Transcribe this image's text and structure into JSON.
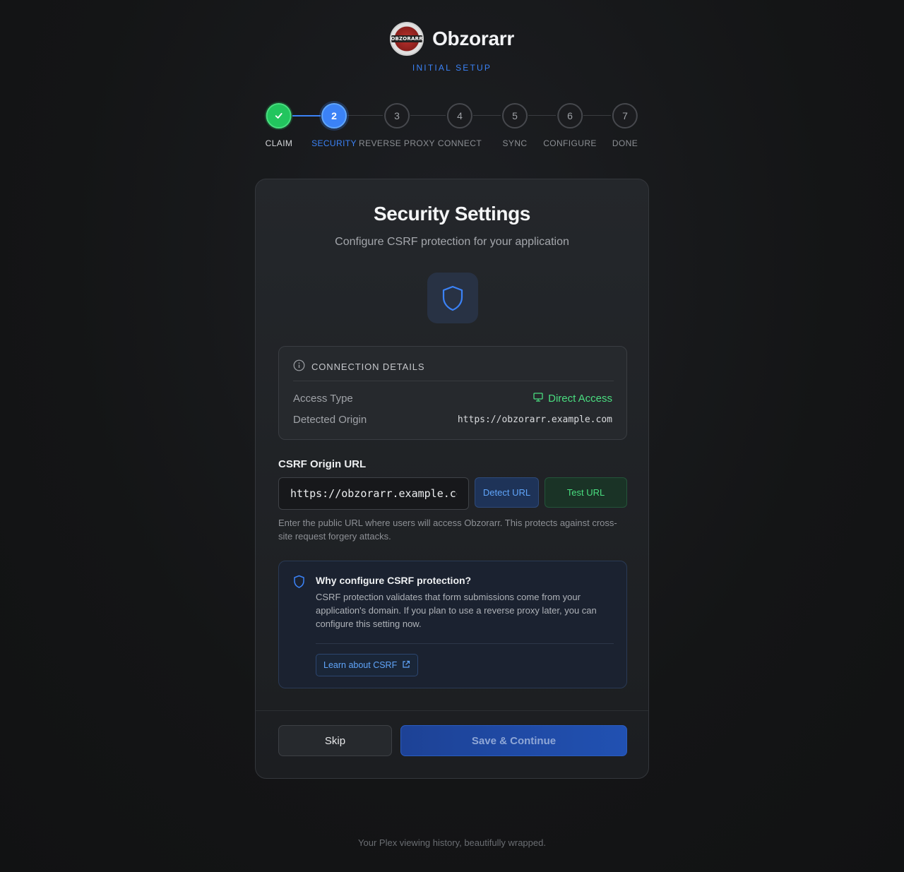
{
  "brand": {
    "name": "Obzorarr",
    "logo_text": "OBZORARR",
    "subtitle": "INITIAL SETUP"
  },
  "steps": [
    {
      "number": "✓",
      "label": "CLAIM",
      "state": "complete"
    },
    {
      "number": "2",
      "label": "SECURITY",
      "state": "active"
    },
    {
      "number": "3",
      "label": "REVERSE PROXY",
      "state": "pending"
    },
    {
      "number": "4",
      "label": "CONNECT",
      "state": "pending"
    },
    {
      "number": "5",
      "label": "SYNC",
      "state": "pending"
    },
    {
      "number": "6",
      "label": "CONFIGURE",
      "state": "pending"
    },
    {
      "number": "7",
      "label": "DONE",
      "state": "pending"
    }
  ],
  "card": {
    "title": "Security Settings",
    "subtitle": "Configure CSRF protection for your application",
    "details": {
      "heading": "CONNECTION DETAILS",
      "access_type_label": "Access Type",
      "access_type_value": "Direct Access",
      "origin_label": "Detected Origin",
      "origin_value": "https://obzorarr.example.com"
    },
    "csrf": {
      "label": "CSRF Origin URL",
      "value": "https://obzorarr.example.com",
      "detect_button": "Detect URL",
      "test_button": "Test URL",
      "help": "Enter the public URL where users will access Obzorarr. This protects against cross-site request forgery attacks."
    },
    "info": {
      "title": "Why configure CSRF protection?",
      "body": "CSRF protection validates that form submissions come from your application's domain. If you plan to use a reverse proxy later, you can configure this setting now.",
      "link": "Learn about CSRF"
    },
    "actions": {
      "skip": "Skip",
      "save": "Save & Continue"
    }
  },
  "tagline": "Your Plex viewing history, beautifully wrapped.",
  "colors": {
    "accent": "#3b82f6",
    "success": "#22c55e",
    "background": "#141516"
  },
  "icons": {
    "step_complete": "check-icon",
    "hero": "shield-icon",
    "details": "info-circle-icon",
    "access": "monitor-icon",
    "info": "shield-icon",
    "link": "external-link-icon"
  }
}
